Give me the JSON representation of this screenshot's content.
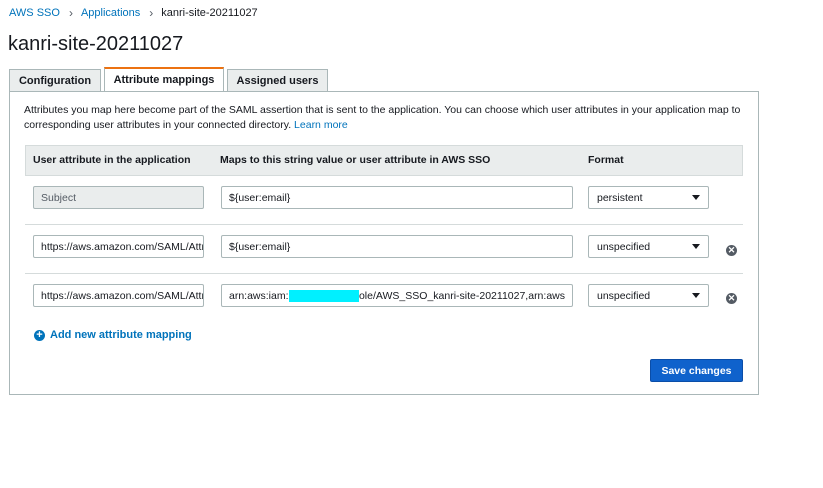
{
  "breadcrumb": [
    "AWS SSO",
    "Applications",
    "kanri-site-20211027"
  ],
  "page_title": "kanri-site-20211027",
  "tabs": [
    {
      "label": "Configuration",
      "active": false
    },
    {
      "label": "Attribute mappings",
      "active": true
    },
    {
      "label": "Assigned users",
      "active": false
    }
  ],
  "description": {
    "text": "Attributes you map here become part of the SAML assertion that is sent to the application. You can choose which user attributes in your application map to corresponding user attributes in your connected directory.",
    "learn_more": "Learn more"
  },
  "table": {
    "headers": [
      "User attribute in the application",
      "Maps to this string value or user attribute in AWS SSO",
      "Format"
    ],
    "rows": [
      {
        "app_attr": "Subject",
        "maps_to": "${user:email}",
        "format": "persistent",
        "removable": false
      },
      {
        "app_attr": "https://aws.amazon.com/SAML/Attributes/RoleSessionName",
        "maps_to": "${user:email}",
        "format": "unspecified",
        "removable": true
      },
      {
        "app_attr": "https://aws.amazon.com/SAML/Attributes/Role",
        "maps_to_prefix": "arn:aws:iam:",
        "maps_to_suffix": "ole/AWS_SSO_kanri-site-20211027,arn:aws",
        "format": "unspecified",
        "removable": true
      }
    ]
  },
  "add_mapping_label": "Add new attribute mapping",
  "save_label": "Save changes",
  "colors": {
    "link": "#0073bb",
    "primary_button": "#0f62cc",
    "active_tab_accent": "#ec7211",
    "redaction": "#00f0ff"
  }
}
